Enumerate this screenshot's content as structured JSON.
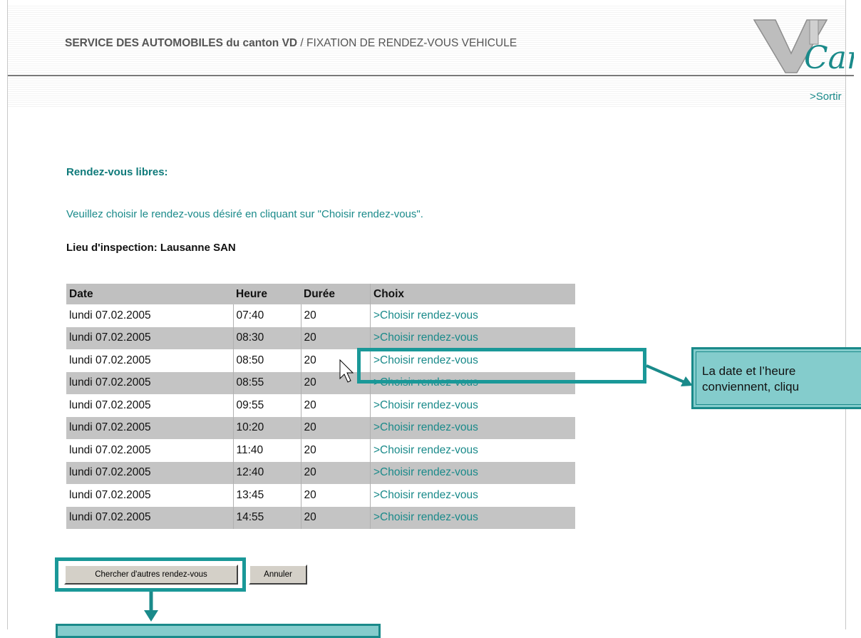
{
  "header": {
    "service_bold": "SERVICE DES AUTOMOBILES du canton  VD",
    "service_sub": " / FIXATION DE RENDEZ-VOUS VEHICULE",
    "logo_text": "Car"
  },
  "nav": {
    "exit_label": ">Sortir"
  },
  "main": {
    "section_title": "Rendez-vous libres:",
    "instruction": "Veuillez choisir le rendez-vous désiré en cliquant sur \"Choisir rendez-vous\".",
    "location": "Lieu d'inspection:  Lausanne SAN"
  },
  "table": {
    "headers": [
      "Date",
      "Heure",
      "Durée",
      "Choix"
    ],
    "rows": [
      {
        "date": "lundi 07.02.2005",
        "heure": "07:40",
        "duree": "20",
        "choix": ">Choisir rendez-vous"
      },
      {
        "date": "lundi 07.02.2005",
        "heure": "08:30",
        "duree": "20",
        "choix": ">Choisir rendez-vous"
      },
      {
        "date": "lundi 07.02.2005",
        "heure": "08:50",
        "duree": "20",
        "choix": ">Choisir rendez-vous"
      },
      {
        "date": "lundi 07.02.2005",
        "heure": "08:55",
        "duree": "20",
        "choix": ">Choisir rendez-vous"
      },
      {
        "date": "lundi 07.02.2005",
        "heure": "09:55",
        "duree": "20",
        "choix": ">Choisir rendez-vous"
      },
      {
        "date": "lundi 07.02.2005",
        "heure": "10:20",
        "duree": "20",
        "choix": ">Choisir rendez-vous"
      },
      {
        "date": "lundi 07.02.2005",
        "heure": "11:40",
        "duree": "20",
        "choix": ">Choisir rendez-vous"
      },
      {
        "date": "lundi 07.02.2005",
        "heure": "12:40",
        "duree": "20",
        "choix": ">Choisir rendez-vous"
      },
      {
        "date": "lundi 07.02.2005",
        "heure": "13:45",
        "duree": "20",
        "choix": ">Choisir rendez-vous"
      },
      {
        "date": "lundi 07.02.2005",
        "heure": "14:55",
        "duree": "20",
        "choix": ">Choisir rendez-vous"
      }
    ]
  },
  "buttons": {
    "search_more": "Chercher d'autres rendez-vous",
    "cancel": "Annuler"
  },
  "annotation": {
    "callout_line1": "La date et l’heure",
    "callout_line2": "conviennent, cliqu"
  },
  "colors": {
    "accent": "#1a8a8a",
    "callout_fill": "#84cccc",
    "row_alt": "#c4c4c4"
  }
}
